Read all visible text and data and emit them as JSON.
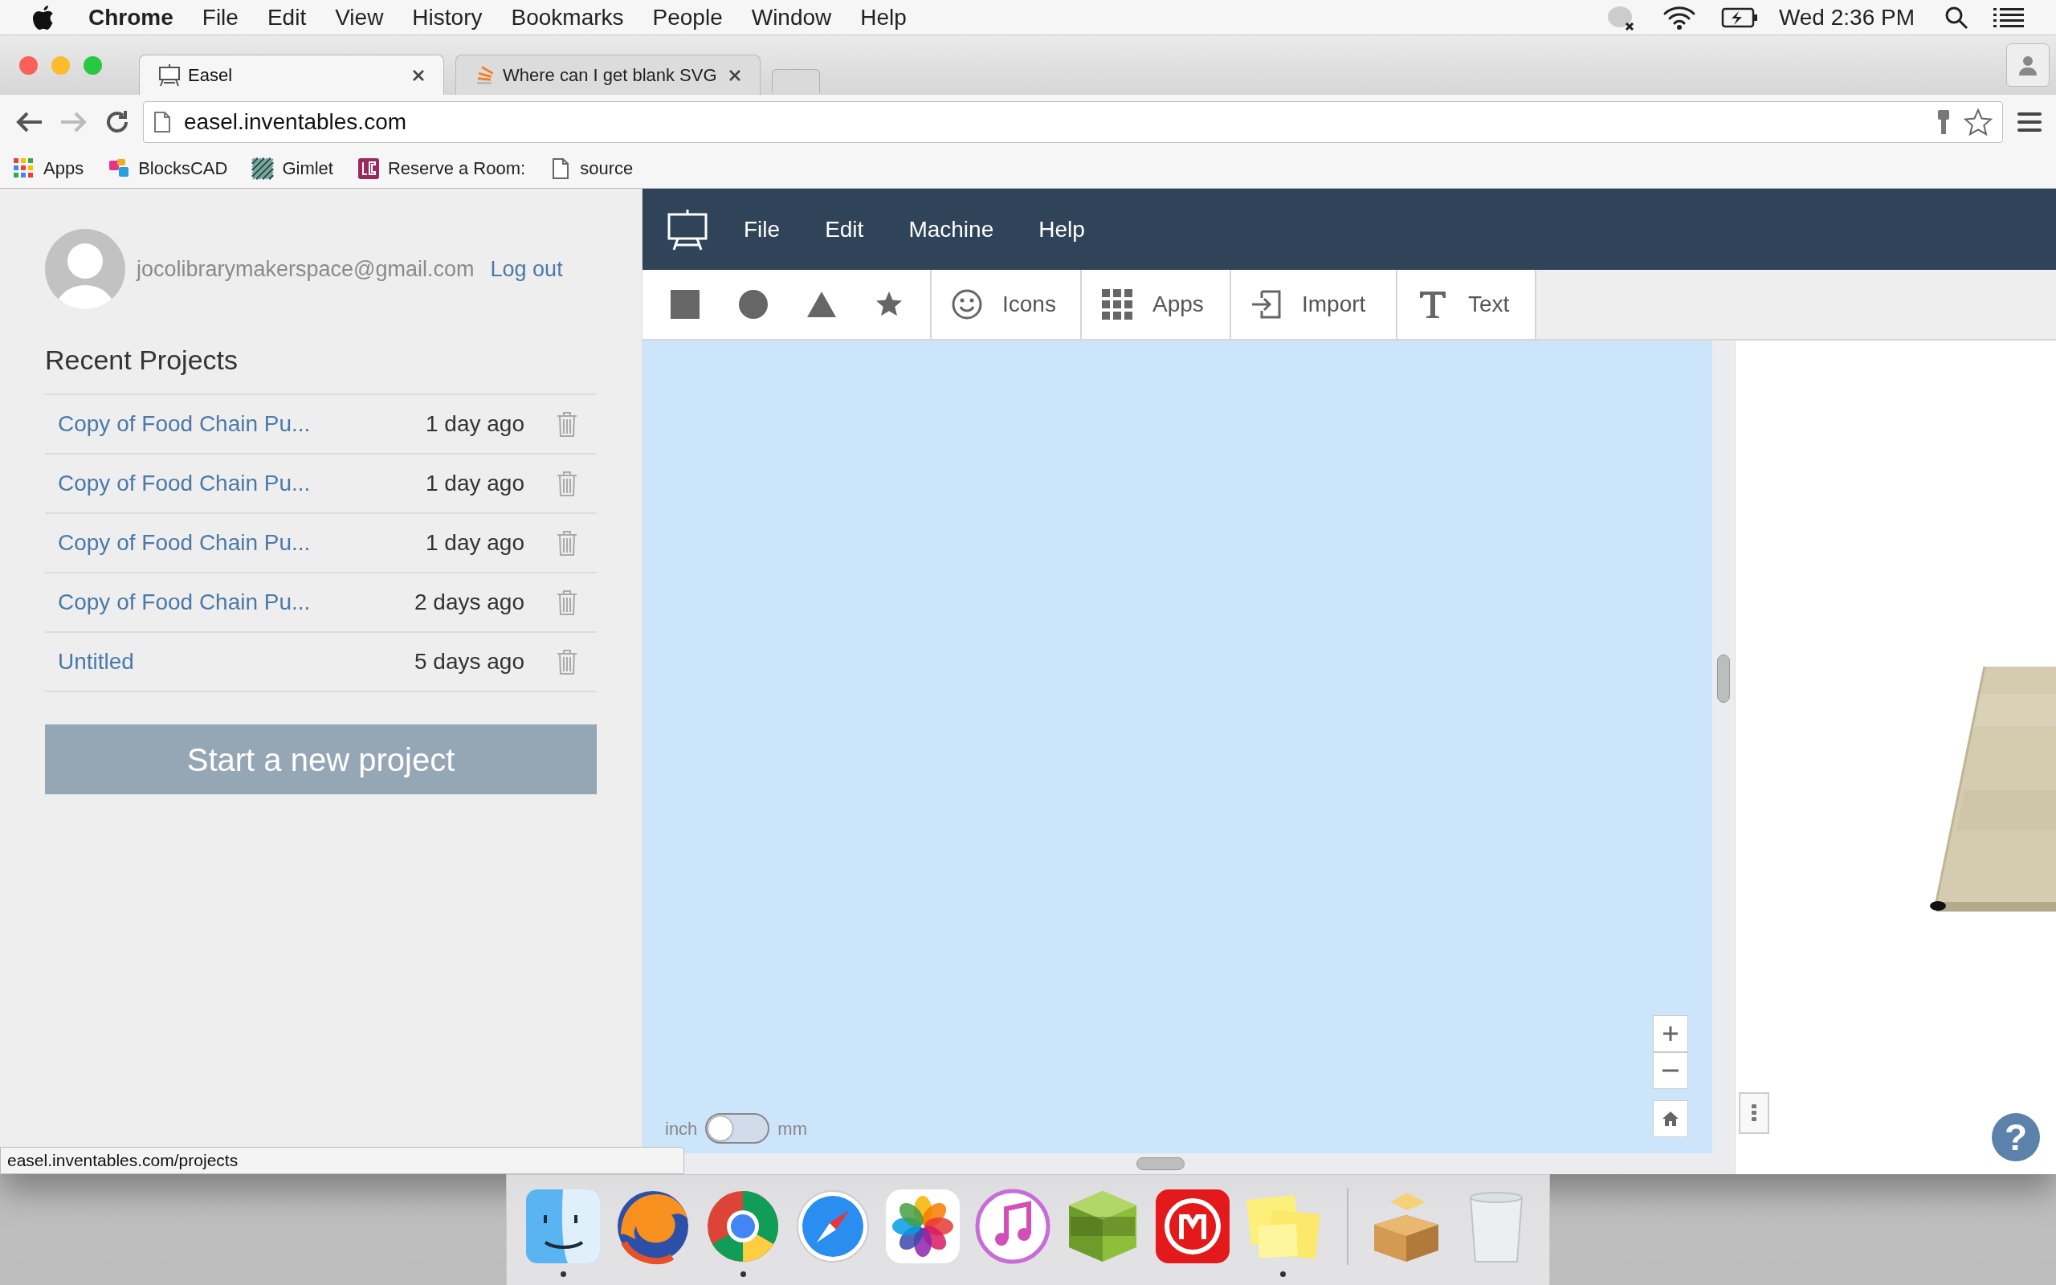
{
  "menu_bar": {
    "app": "Chrome",
    "items": [
      "File",
      "Edit",
      "View",
      "History",
      "Bookmarks",
      "People",
      "Window",
      "Help"
    ],
    "clock": "Wed 2:36 PM"
  },
  "browser": {
    "tabs": [
      {
        "title": "Easel",
        "selected": true
      },
      {
        "title": "Where can I get blank SVG",
        "selected": false
      }
    ],
    "address": "easel.inventables.com",
    "bookmarks": [
      "Apps",
      "BlocksCAD",
      "Gimlet",
      "Reserve a Room:",
      "source"
    ]
  },
  "account": {
    "email": "jocolibrarymakerspace@gmail.com",
    "logout": "Log out"
  },
  "recent_projects": {
    "title": "Recent Projects",
    "items": [
      {
        "name": "Copy of Food Chain Pu...",
        "age": "1 day ago"
      },
      {
        "name": "Copy of Food Chain Pu...",
        "age": "1 day ago"
      },
      {
        "name": "Copy of Food Chain Pu...",
        "age": "1 day ago"
      },
      {
        "name": "Copy of Food Chain Pu...",
        "age": "2 days ago"
      },
      {
        "name": "Untitled",
        "age": "5 days ago"
      }
    ],
    "new_button": "Start a new project"
  },
  "app_menu": [
    "File",
    "Edit",
    "Machine",
    "Help"
  ],
  "toolbar": [
    "Icons",
    "Apps",
    "Import",
    "Text"
  ],
  "units": {
    "left": "inch",
    "right": "mm",
    "on": false
  },
  "help": "?",
  "status_url": "easel.inventables.com/projects",
  "dock": [
    {
      "running": true
    },
    {
      "running": false
    },
    {
      "running": true
    },
    {
      "running": false
    },
    {
      "running": false
    },
    {
      "running": false
    },
    {
      "running": false
    },
    {
      "running": false
    },
    {
      "running": true
    },
    {
      "running": false
    },
    {
      "running": false
    }
  ]
}
